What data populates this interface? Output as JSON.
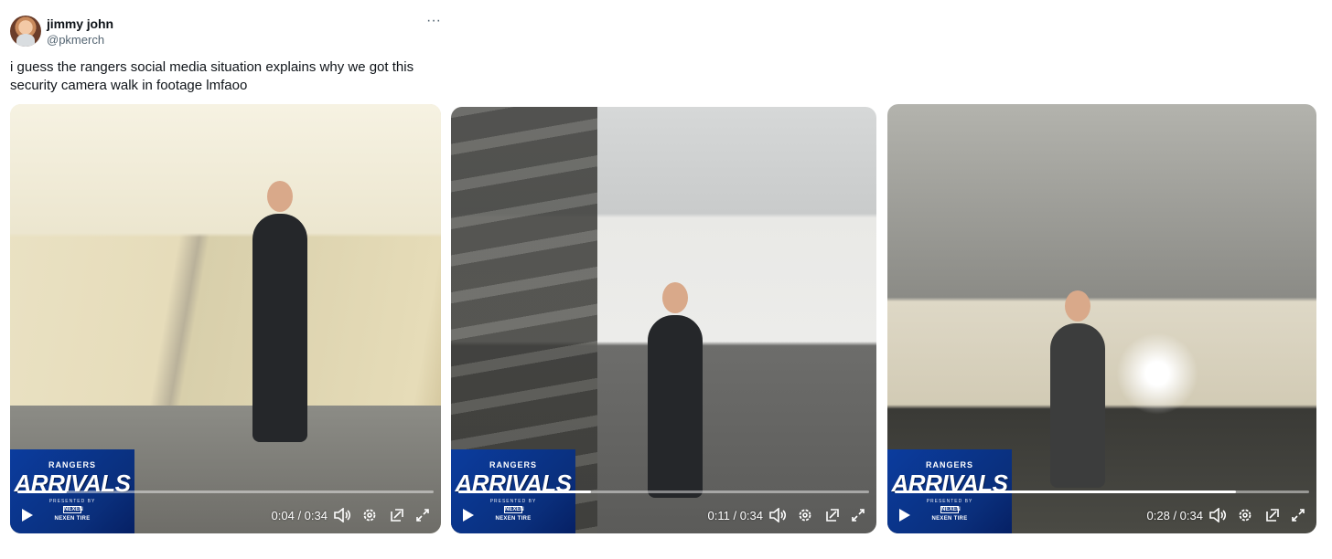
{
  "author": {
    "name": "jimmy john",
    "handle": "@pkmerch"
  },
  "more_label": "···",
  "tweet_text": "i guess the rangers social media situation explains why we got this security camera walk in footage lmfaoo",
  "badge": {
    "top": "RANGERS",
    "main": "ARRIVALS",
    "sub": "PRESENTED BY",
    "logo": "NEXEN",
    "brand": "NEXEN TIRE"
  },
  "videos": [
    {
      "time": "0:04 / 0:34",
      "progress_fraction": 0.118
    },
    {
      "time": "0:11 / 0:34",
      "progress_fraction": 0.324
    },
    {
      "time": "0:28 / 0:34",
      "progress_fraction": 0.824
    }
  ],
  "icons": [
    "play-icon",
    "volume-icon",
    "gear-icon",
    "picture-in-picture-icon",
    "fullscreen-icon"
  ]
}
